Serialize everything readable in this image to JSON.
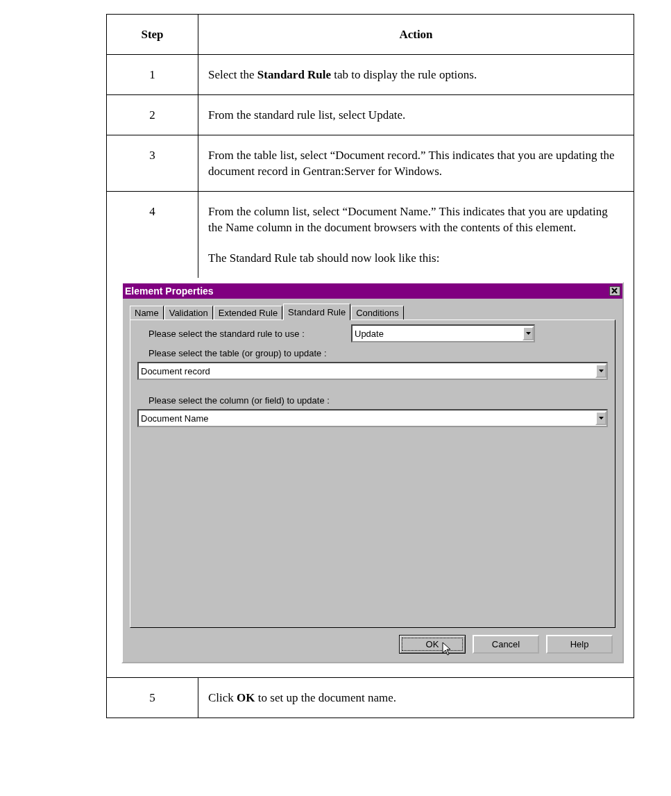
{
  "table": {
    "columns": [
      "Step",
      "Action"
    ],
    "rows": [
      {
        "step": "1",
        "action": "Select the **Standard Rule** tab to display the rule options."
      },
      {
        "step": "2",
        "action": "From the standard rule list, select Update."
      },
      {
        "step": "3",
        "action": "From the table list, select “Document record.” This indicates that you are updating the document record in Gentran:Server for Windows."
      },
      {
        "step": "4",
        "action": "From the column list, select “Document Name.” This indicates that you are updating the Name column in the document browsers with the contents of this element.",
        "caption": "The Standard Rule tab should now look like this:",
        "dialog": {
          "title": "Element Properties",
          "tabs": [
            {
              "label": "Name",
              "selected": false
            },
            {
              "label": "Validation",
              "selected": false
            },
            {
              "label": "Extended Rule",
              "selected": false
            },
            {
              "label": "Standard Rule",
              "selected": true
            },
            {
              "label": "Conditions",
              "selected": false
            }
          ],
          "fields": [
            {
              "kind": "inline",
              "label": "Please select the standard rule to use :",
              "value": "Update"
            },
            {
              "kind": "stacked",
              "label": "Please select the table (or group) to update :",
              "value": "Document record"
            },
            {
              "kind": "stacked",
              "label": "Please select the column (or field) to update :",
              "value": "Document Name"
            }
          ],
          "buttons": [
            {
              "label": "OK",
              "focused": true
            },
            {
              "label": "Cancel",
              "focused": false
            },
            {
              "label": "Help",
              "focused": false
            }
          ]
        }
      },
      {
        "step": "5",
        "action": "Click **OK** to set up the document name."
      }
    ]
  }
}
